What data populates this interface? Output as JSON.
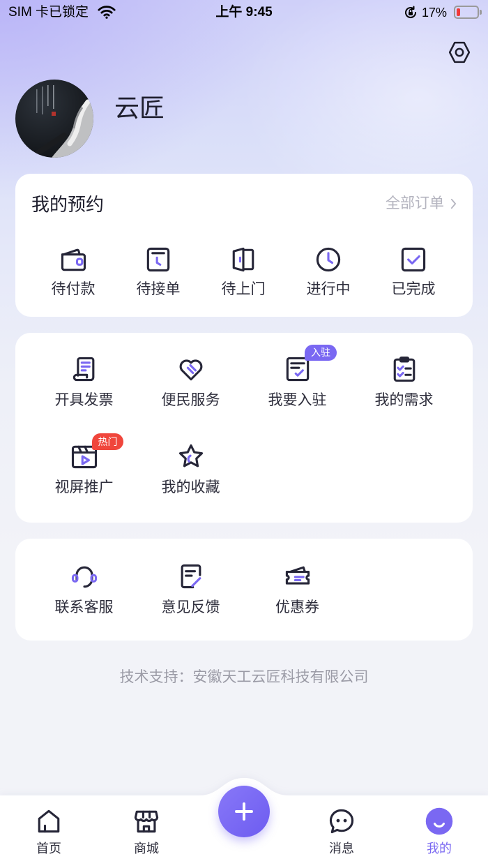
{
  "status_bar": {
    "carrier": "SIM 卡已锁定",
    "time": "上午 9:45",
    "battery_text": "17%",
    "battery_level": 0.17
  },
  "header": {
    "settings_icon": "settings-icon",
    "user_name": "云匠"
  },
  "appointments": {
    "title": "我的预约",
    "all_orders_label": "全部订单",
    "items": [
      {
        "label": "待付款",
        "icon": "wallet-icon"
      },
      {
        "label": "待接单",
        "icon": "pending-order-icon"
      },
      {
        "label": "待上门",
        "icon": "door-icon"
      },
      {
        "label": "进行中",
        "icon": "clock-icon"
      },
      {
        "label": "已完成",
        "icon": "check-square-icon"
      }
    ]
  },
  "services": {
    "items": [
      {
        "label": "开具发票",
        "icon": "invoice-icon"
      },
      {
        "label": "便民服务",
        "icon": "heart-handshake-icon"
      },
      {
        "label": "我要入驻",
        "icon": "settle-in-icon",
        "badge": "入驻"
      },
      {
        "label": "我的需求",
        "icon": "checklist-icon"
      },
      {
        "label": "视屏推广",
        "icon": "video-icon",
        "badge": "热门"
      },
      {
        "label": "我的收藏",
        "icon": "star-icon"
      }
    ]
  },
  "support": {
    "items": [
      {
        "label": "联系客服",
        "icon": "headset-icon"
      },
      {
        "label": "意见反馈",
        "icon": "feedback-icon"
      },
      {
        "label": "优惠券",
        "icon": "coupon-icon"
      }
    ]
  },
  "footer": {
    "text": "技术支持：安徽天工云匠科技有限公司"
  },
  "tab_bar": {
    "items": [
      {
        "label": "首页",
        "icon": "home-icon",
        "active": false
      },
      {
        "label": "商城",
        "icon": "store-icon",
        "active": false
      },
      {
        "label": "消息",
        "icon": "message-icon",
        "active": false
      },
      {
        "label": "我的",
        "icon": "profile-icon",
        "active": true
      }
    ],
    "center_button_icon": "plus-icon"
  },
  "colors": {
    "accent": "#7a68f2",
    "badge_join": "#7a68f2",
    "badge_hot": "#f0463c",
    "battery_low": "#f03a3a",
    "card": "#ffffff",
    "page_bg": "#f2f3f8"
  }
}
